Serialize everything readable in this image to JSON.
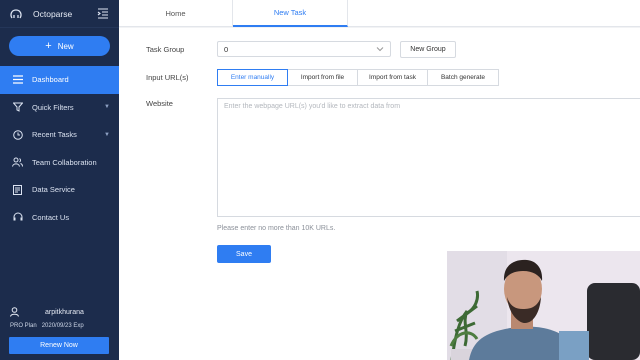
{
  "app": {
    "name": "Octoparse"
  },
  "sidebar": {
    "new_label": "New",
    "items": [
      {
        "label": "Dashboard",
        "icon": "menu-icon",
        "active": true
      },
      {
        "label": "Quick Filters",
        "icon": "filter-icon",
        "expandable": true
      },
      {
        "label": "Recent Tasks",
        "icon": "clock-icon",
        "expandable": true
      },
      {
        "label": "Team Collaboration",
        "icon": "team-icon"
      },
      {
        "label": "Data Service",
        "icon": "document-icon"
      },
      {
        "label": "Contact Us",
        "icon": "headset-icon"
      }
    ],
    "user": {
      "name": "arpitkhurana",
      "plan": "PRO Plan",
      "expiry": "2020/09/23 Exp"
    },
    "renew_label": "Renew Now"
  },
  "tabs": [
    {
      "label": "Home",
      "active": false
    },
    {
      "label": "New Task",
      "active": true
    }
  ],
  "form": {
    "task_group_label": "Task Group",
    "task_group_value": "0",
    "new_group_label": "New Group",
    "input_urls_label": "Input URL(s)",
    "input_options": [
      "Enter manually",
      "Import from file",
      "Import from task",
      "Batch generate"
    ],
    "selected_option": "Enter manually",
    "website_label": "Website",
    "website_placeholder": "Enter the webpage URL(s) you'd like to extract data from",
    "hint": "Please enter no more than 10K URLs.",
    "save_label": "Save"
  },
  "colors": {
    "sidebar": "#1c2c4c",
    "accent": "#2f7df2"
  }
}
